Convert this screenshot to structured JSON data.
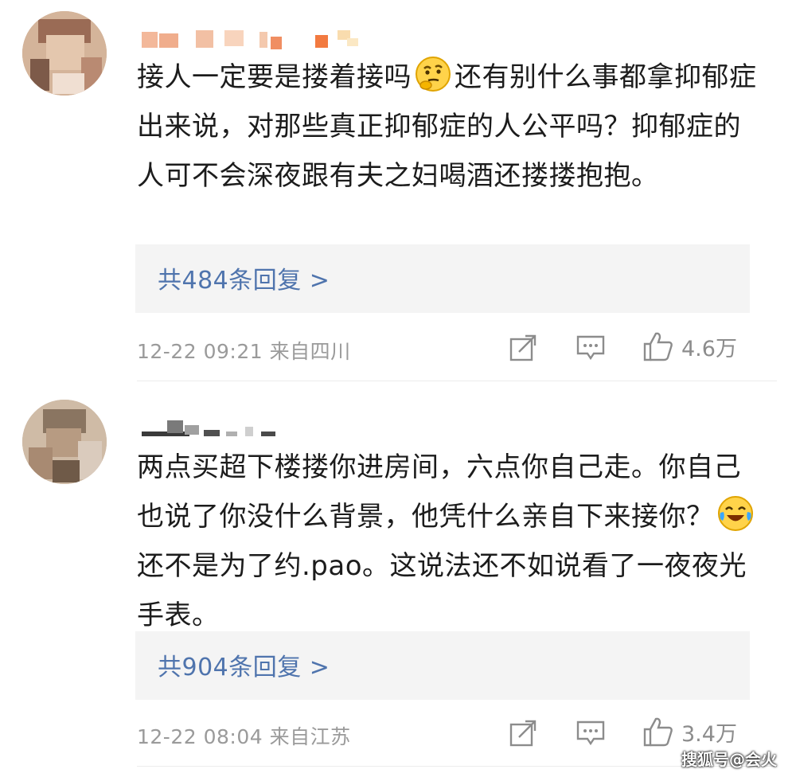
{
  "comments": [
    {
      "text_before_emoji": "接人一定要是搂着接吗",
      "emoji_name": "thinking-emoji",
      "text_after_emoji": "还有别什么事都拿抑郁症出来说，对那些真正抑郁症的人公平吗？抑郁症的人可不会深夜跟有夫之妇喝酒还搂搂抱抱。",
      "replies_label": "共484条回复 >",
      "timestamp": "12-22 09:21 来自四川",
      "like_count": "4.6万"
    },
    {
      "text_before_emoji": "两点买超下楼搂你进房间，六点你自己走。你自己也说了你没什么背景，他凭什么亲自下来接你？",
      "emoji_name": "laugh-cry-emoji",
      "text_after_emoji": "还不是为了约.pao。这说法还不如说看了一夜夜光手表。",
      "replies_label": "共904条回复 >",
      "timestamp": "12-22 08:04 来自江苏",
      "like_count": "3.4万"
    }
  ],
  "icons": {
    "share": "share-icon",
    "comment": "comment-icon",
    "like": "thumbs-up-icon"
  },
  "colors": {
    "link": "#4f74ad",
    "meta": "#9a9a9a",
    "reply_bg": "#f4f4f4"
  },
  "watermark": "搜狐号@会火"
}
